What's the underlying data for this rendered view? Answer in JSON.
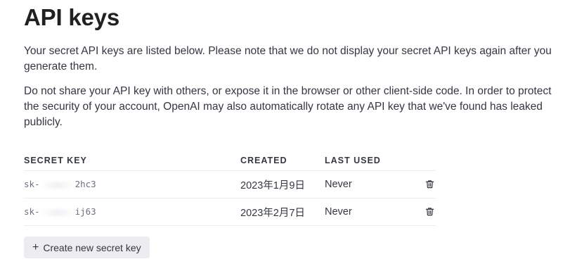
{
  "page": {
    "title": "API keys",
    "description_1": "Your secret API keys are listed below. Please note that we do not display your secret API keys again after you generate them.",
    "description_2": "Do not share your API key with others, or expose it in the browser or other client-side code. In order to protect the security of your account, OpenAI may also automatically rotate any API key that we've found has leaked publicly."
  },
  "table": {
    "headers": {
      "secret_key": "SECRET KEY",
      "created": "CREATED",
      "last_used": "LAST USED"
    },
    "rows": [
      {
        "key_prefix": "sk-",
        "key_suffix": "2hc3",
        "created": "2023年1月9日",
        "last_used": "Never"
      },
      {
        "key_prefix": "sk-",
        "key_suffix": "ij63",
        "created": "2023年2月7日",
        "last_used": "Never"
      }
    ]
  },
  "actions": {
    "create_label": "Create new secret key",
    "create_icon": "plus-icon",
    "delete_icon": "trash-icon"
  },
  "colors": {
    "text": "#353740",
    "heading": "#202123",
    "border": "#ececf1",
    "button_bg": "#ececf1"
  }
}
